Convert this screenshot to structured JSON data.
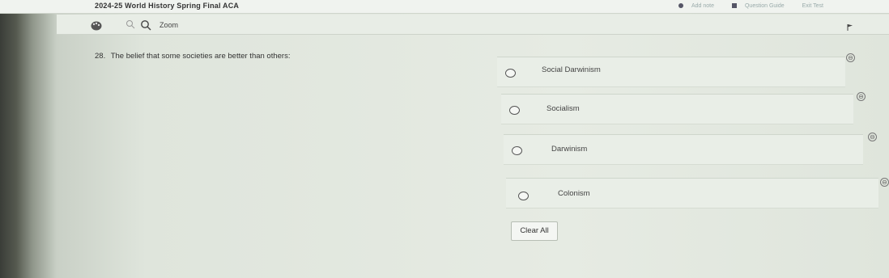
{
  "header": {
    "title": "2024-25 World History Spring Final ACA",
    "add_note": "Add note",
    "question_guide": "Question Guide",
    "exit": "Exit Test"
  },
  "toolbar": {
    "zoom_label": "Zoom",
    "icons": [
      "palette-icon",
      "zoom-out-icon",
      "zoom-in-icon",
      "flag-icon"
    ]
  },
  "question": {
    "number": "28.",
    "text": "The belief that some societies are better than others:"
  },
  "choices": [
    {
      "label": "Social Darwinism"
    },
    {
      "label": "Socialism"
    },
    {
      "label": "Darwinism"
    },
    {
      "label": "Colonism"
    }
  ],
  "actions": {
    "clear_all": "Clear All"
  }
}
